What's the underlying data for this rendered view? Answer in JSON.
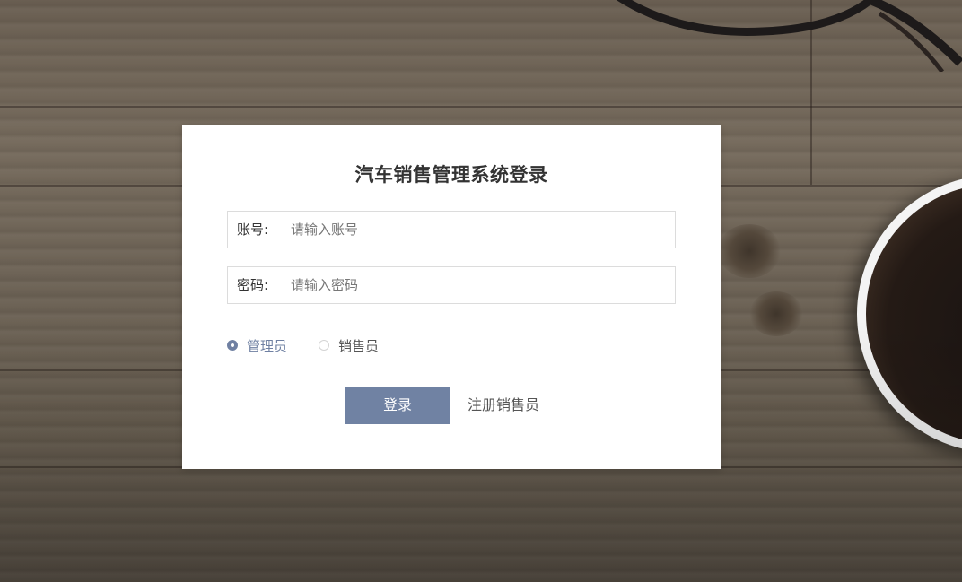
{
  "login": {
    "title": "汽车销售管理系统登录",
    "account": {
      "label": "账号:",
      "placeholder": "请输入账号",
      "value": ""
    },
    "password": {
      "label": "密码:",
      "placeholder": "请输入密码",
      "value": ""
    },
    "roles": [
      {
        "label": "管理员",
        "checked": true
      },
      {
        "label": "销售员",
        "checked": false
      }
    ],
    "login_button": "登录",
    "register_link": "注册销售员"
  },
  "colors": {
    "accent": "#7082a3",
    "card_background": "#ffffff",
    "title_text": "#333333",
    "radio_checked": "#6f80a2"
  },
  "icons": {
    "role_checked": "radio-checked-icon",
    "role_unchecked": "radio-unchecked-icon"
  }
}
